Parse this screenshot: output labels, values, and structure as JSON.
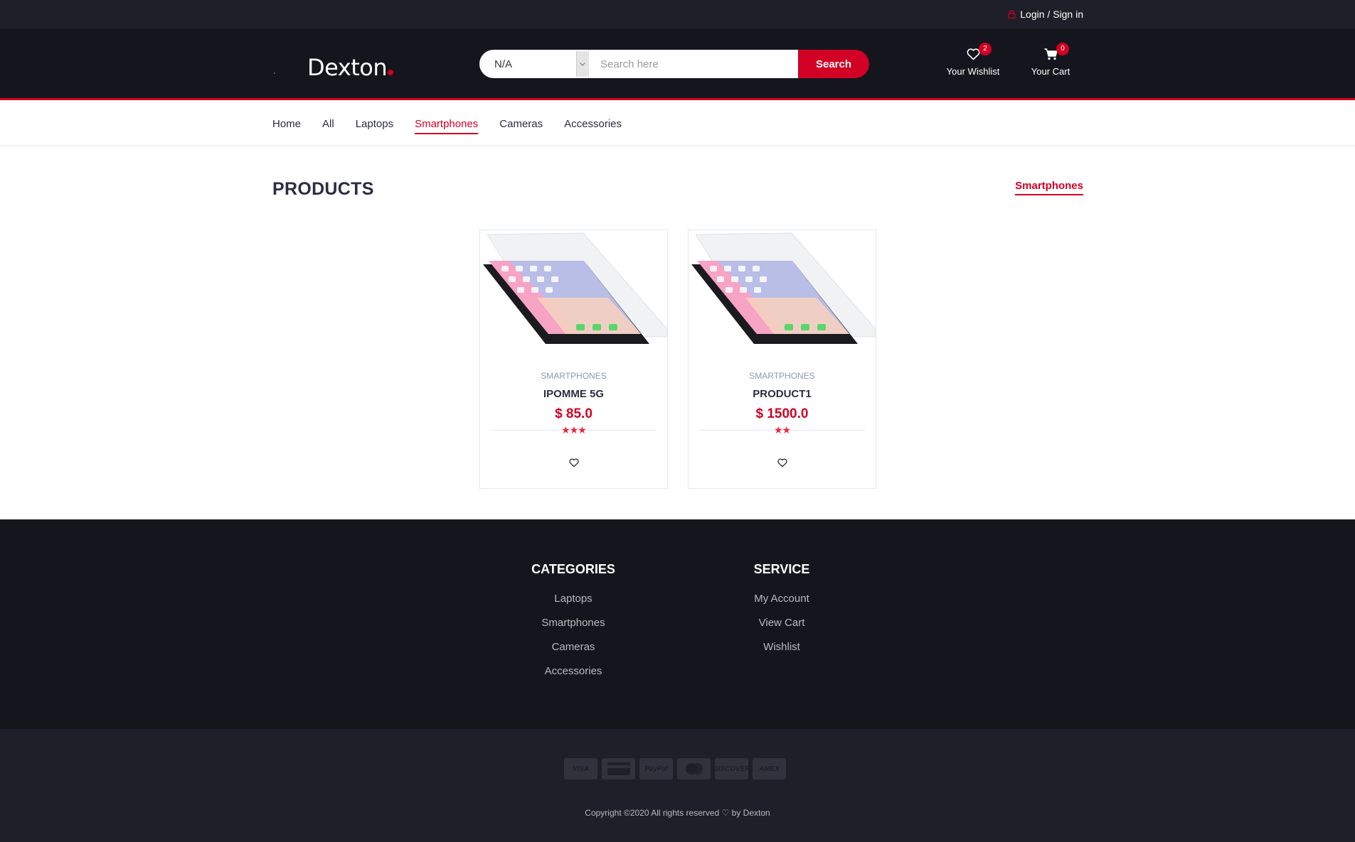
{
  "topbar": {
    "login_label": "Login / Sign in"
  },
  "header": {
    "logo_text": "Dexton",
    "search": {
      "category_value": "N/A",
      "placeholder": "Search here",
      "button_label": "Search"
    },
    "wishlist": {
      "label": "Your Wishlist",
      "count": "2"
    },
    "cart": {
      "label": "Your Cart",
      "count": "0"
    }
  },
  "nav": {
    "items": [
      {
        "label": "Home"
      },
      {
        "label": "All"
      },
      {
        "label": "Laptops"
      },
      {
        "label": "Smartphones",
        "active": true
      },
      {
        "label": "Cameras"
      },
      {
        "label": "Accessories"
      }
    ]
  },
  "main": {
    "title": "PRODUCTS",
    "active_filter": "Smartphones",
    "products": [
      {
        "category": "SMARTPHONES",
        "name": "IPOMME 5G",
        "price": "$ 85.0",
        "rating": 3
      },
      {
        "category": "SMARTPHONES",
        "name": "PRODUCT1",
        "price": "$ 1500.0",
        "rating": 2
      }
    ]
  },
  "footer": {
    "categories": {
      "title": "CATEGORIES",
      "links": [
        "Laptops",
        "Smartphones",
        "Cameras",
        "Accessories"
      ]
    },
    "service": {
      "title": "SERVICE",
      "links": [
        "My Account",
        "View Cart",
        "Wishlist"
      ]
    },
    "payments": [
      "VISA",
      "credit-card",
      "PayPal",
      "mastercard",
      "DISCOVER",
      "AMEX"
    ],
    "copyright": "Copyright ©2020 All rights reserved ♡ by Dexton"
  },
  "colors": {
    "accent": "#d10024",
    "header_bg": "#15161d",
    "topbar_bg": "#1e1f29"
  },
  "icons": [
    "lock-icon",
    "heart-icon",
    "cart-icon",
    "chevron-down-icon"
  ]
}
